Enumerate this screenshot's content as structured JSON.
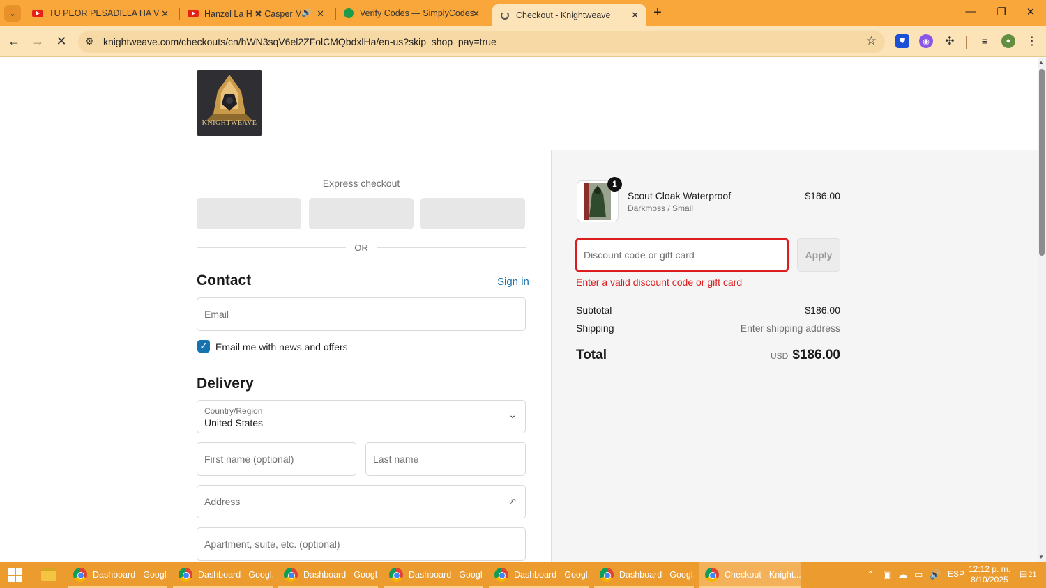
{
  "browser": {
    "tabs": [
      {
        "title": "TU PEOR PESADILLA HA VUELTO",
        "icon": "youtube-icon",
        "active": false
      },
      {
        "title": "Hanzel La H ✖ Casper Mágico",
        "icon": "youtube-icon",
        "active": false,
        "audio": true
      },
      {
        "title": "Verify Codes — SimplyCodes",
        "icon": "simplycodes-icon",
        "active": false
      },
      {
        "title": "Checkout - Knightweave",
        "icon": "loading-icon",
        "active": true
      }
    ],
    "url": "knightweave.com/checkouts/cn/hWN3sqV6el2ZFolCMQbdxlHa/en-us?skip_shop_pay=true"
  },
  "store": {
    "logo_text": "KNIGHTWEAVE"
  },
  "checkout": {
    "express_title": "Express checkout",
    "or_text": "OR",
    "contact": {
      "heading": "Contact",
      "sign_in": "Sign in",
      "email_placeholder": "Email",
      "news_label": "Email me with news and offers",
      "news_checked": true
    },
    "delivery": {
      "heading": "Delivery",
      "country_label": "Country/Region",
      "country_value": "United States",
      "first_name_placeholder": "First name (optional)",
      "last_name_placeholder": "Last name",
      "address_placeholder": "Address",
      "apartment_placeholder": "Apartment, suite, etc. (optional)"
    }
  },
  "order_summary": {
    "item": {
      "name": "Scout Cloak Waterproof",
      "variant": "Darkmoss / Small",
      "price": "$186.00",
      "quantity": "1"
    },
    "discount_placeholder": "Discount code or gift card",
    "apply_label": "Apply",
    "error": "Enter a valid discount code or gift card",
    "subtotal_label": "Subtotal",
    "subtotal_value": "$186.00",
    "shipping_label": "Shipping",
    "shipping_value": "Enter shipping address",
    "total_label": "Total",
    "total_currency": "USD",
    "total_value": "$186.00"
  },
  "taskbar": {
    "apps": [
      {
        "title": "Dashboard - Googl...",
        "active": false
      },
      {
        "title": "Dashboard - Googl...",
        "active": false
      },
      {
        "title": "Dashboard - Googl...",
        "active": false
      },
      {
        "title": "Dashboard - Googl...",
        "active": false
      },
      {
        "title": "Dashboard - Googl...",
        "active": false
      },
      {
        "title": "Dashboard - Googl...",
        "active": false
      },
      {
        "title": "Checkout - Knight...",
        "active": true
      }
    ],
    "language": "ESP",
    "time": "12:12 p. m.",
    "date": "8/10/2025",
    "notifications": "21"
  }
}
